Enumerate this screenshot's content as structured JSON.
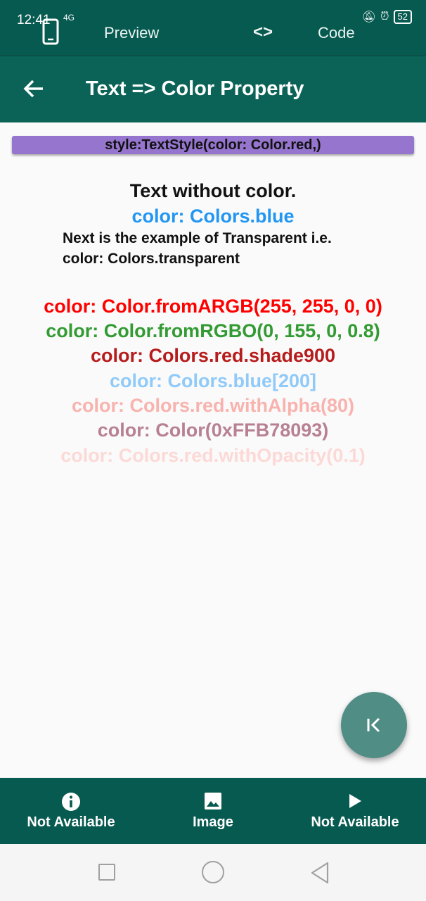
{
  "status": {
    "time": "12:41",
    "network": "4G",
    "battery": "52"
  },
  "tabs": {
    "preview": "Preview",
    "code_icon": "<>",
    "code": "Code"
  },
  "appbar": {
    "title": "Text => Color Property"
  },
  "banner": "style:TextStyle(color: Color.red,)",
  "samples": {
    "plain": "Text without color.",
    "blue": "color: Colors.blue",
    "transparent_line1": "Next is the example of Transparent i.e.",
    "transparent_line2": "color: Colors.transparent",
    "argb": "color: Color.fromARGB(255, 255, 0, 0)",
    "rgbo": "color: Color.fromRGBO(0, 155, 0, 0.8)",
    "shade900": "color: Colors.red.shade900",
    "blue200": "color: Colors.blue[200]",
    "with_alpha": "color: Colors.red.withAlpha(80)",
    "color_hex": "color: Color(0xFFB78093)",
    "with_opacity": "color: Colors.red.withOpacity(0.1)"
  },
  "sample_colors": {
    "plain": "#111111",
    "blue": "#2196f3",
    "argb": "#ff0000",
    "rgbo": "#339b33",
    "shade900": "#b71c1c",
    "blue200": "#90caf9",
    "with_alpha": "#f8b3ae",
    "color_hex": "#b78093",
    "with_opacity": "#fcd9d6"
  },
  "bottom_nav": {
    "items": [
      {
        "label": "Not Available",
        "icon": "info-icon"
      },
      {
        "label": "Image",
        "icon": "image-icon"
      },
      {
        "label": "Not Available",
        "icon": "play-icon"
      }
    ]
  },
  "colors": {
    "primary_dark": "#075a50",
    "primary": "#0b6357",
    "banner": "#9575cd",
    "fab": "#4f8d85"
  }
}
